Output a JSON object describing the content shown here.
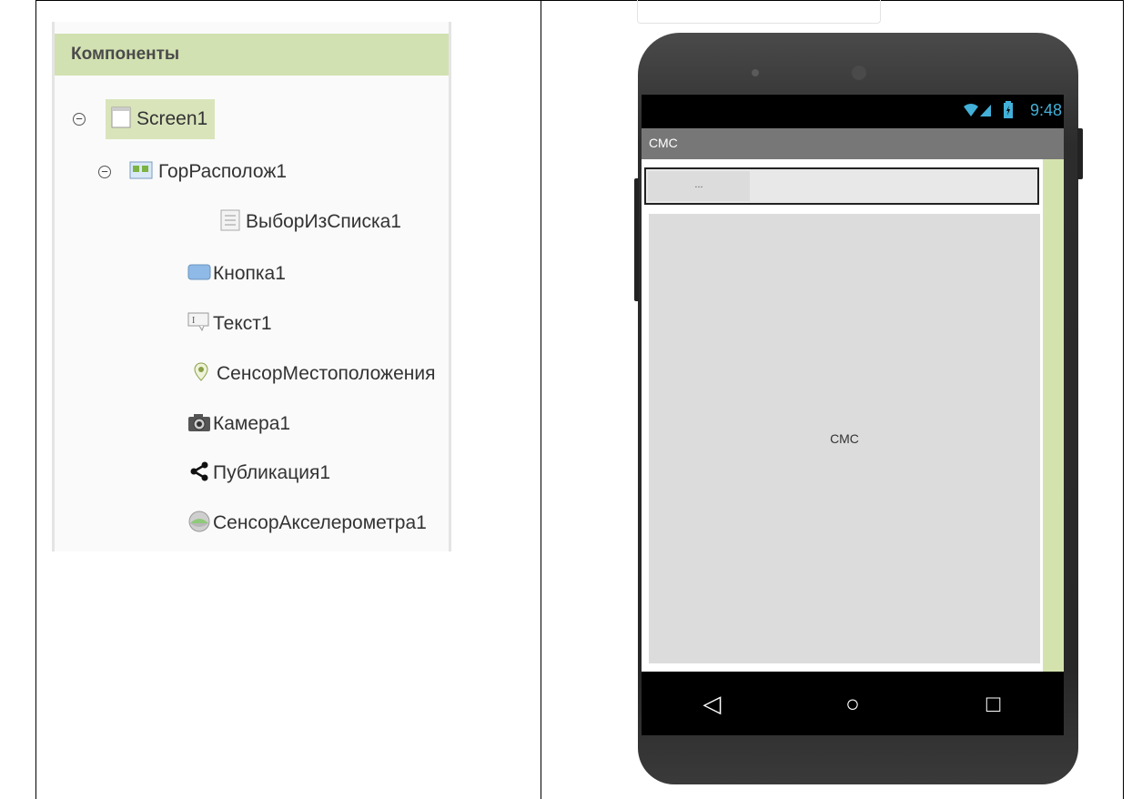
{
  "components_panel": {
    "header": "Компоненты",
    "tree": [
      {
        "label": "Screen1",
        "icon": "screen-icon"
      },
      {
        "label": "ГорРасполож1",
        "icon": "horizontal-arrangement-icon"
      },
      {
        "label": "ВыборИзСписка1",
        "icon": "list-picker-icon"
      },
      {
        "label": "Кнопка1",
        "icon": "button-icon"
      },
      {
        "label": "Текст1",
        "icon": "textbox-icon"
      },
      {
        "label": "СенсорМестоположения",
        "icon": "location-sensor-icon"
      },
      {
        "label": "Камера1",
        "icon": "camera-icon"
      },
      {
        "label": "Публикация1",
        "icon": "sharing-icon"
      },
      {
        "label": "СенсорАкселерометра1",
        "icon": "accelerometer-icon"
      }
    ]
  },
  "phone": {
    "status_time": "9:48",
    "title": "СМС",
    "list_picker_text": "...",
    "button_text": "СМС",
    "nav": {
      "back": "◁",
      "home": "○",
      "recent": "□"
    }
  },
  "colors": {
    "header_bg": "#d2e1b1",
    "selected_bg": "#d9e4bb",
    "title_bar": "#777777",
    "clock": "#42b0d8"
  }
}
